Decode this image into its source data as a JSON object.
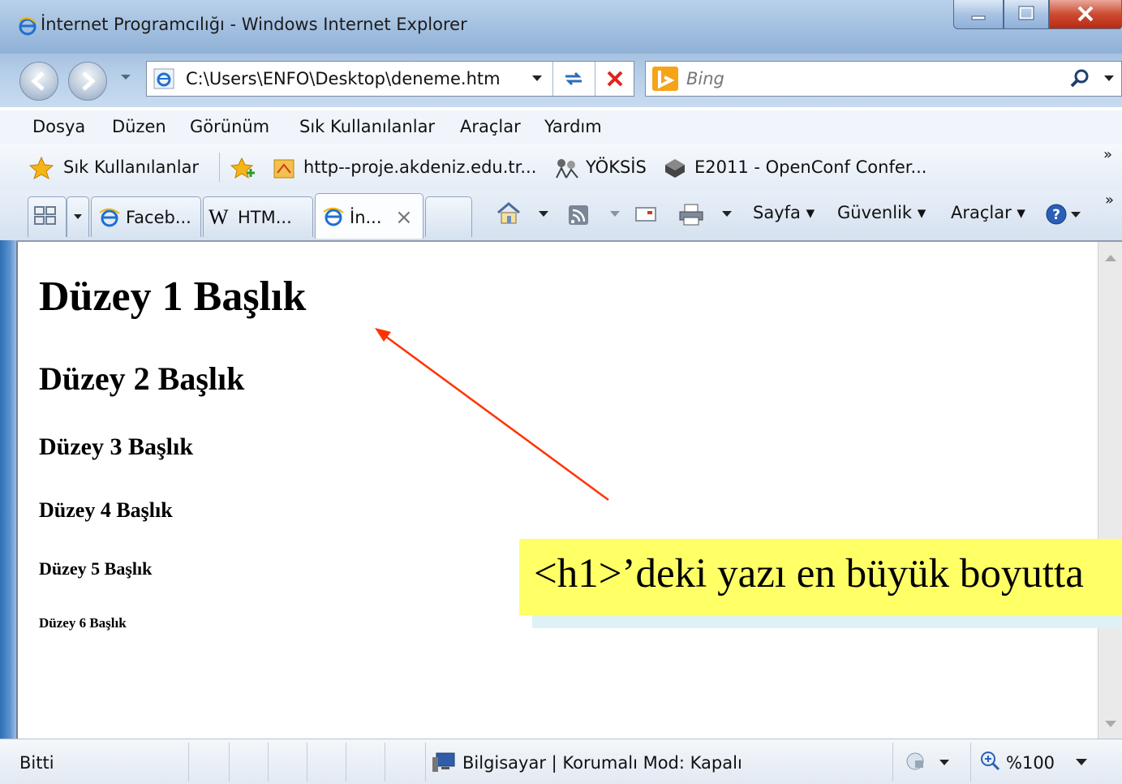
{
  "window": {
    "title": "İnternet Programcılığı - Windows Internet Explorer"
  },
  "navigation": {
    "address": "C:\\Users\\ENFO\\Desktop\\deneme.htm",
    "search_placeholder": "Bing"
  },
  "menu": {
    "items": [
      "Dosya",
      "Düzen",
      "Görünüm",
      "Sık Kullanılanlar",
      "Araçlar",
      "Yardım"
    ]
  },
  "favorites": {
    "label": "Sık Kullanılanlar",
    "links": [
      "http--proje.akdeniz.edu.tr...",
      "YÖKSİS",
      "E2011 - OpenConf Confer..."
    ],
    "chevron": "»"
  },
  "tabs": {
    "items": [
      "Faceb...",
      "HTM...",
      "İn..."
    ],
    "close_glyph": "×"
  },
  "commandbar": {
    "page": "Sayfa ▾",
    "safety": "Güvenlik ▾",
    "tools": "Araçlar ▾",
    "chevron": "»"
  },
  "page": {
    "headings": [
      "Düzey 1 Başlık",
      "Düzey 2 Başlık",
      "Düzey 3 Başlık",
      "Düzey 4 Başlık",
      "Düzey 5 Başlık",
      "Düzey 6 Başlık"
    ]
  },
  "callout": {
    "text": "<h1>’deki yazı en büyük boyutta"
  },
  "status": {
    "left": "Bitti",
    "zone": "Bilgisayar | Korumalı Mod: Kapalı",
    "zoom": "%100"
  },
  "colors": {
    "callout_bg": "#ffff66",
    "arrow": "#ff3300",
    "close_button": "#cc4b32"
  }
}
